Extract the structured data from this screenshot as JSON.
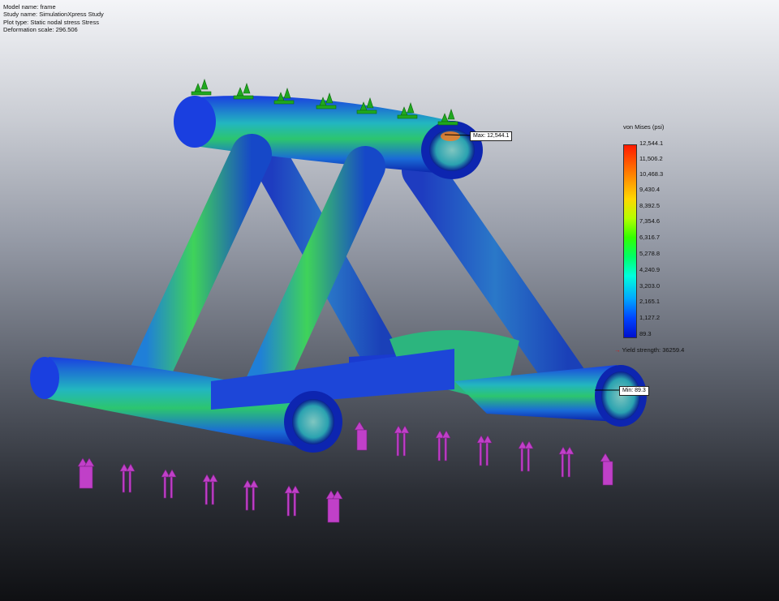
{
  "info": {
    "model_name": "Model name: frame",
    "study_name": "Study name: SimulationXpress Study",
    "plot_type": "Plot type: Static nodal stress Stress",
    "deformation_scale": "Deformation scale: 296.506"
  },
  "legend": {
    "title": "von Mises (psi)",
    "ticks": [
      "12,544.1",
      "11,506.2",
      "10,468.3",
      "9,430.4",
      "8,392.5",
      "7,354.6",
      "6,316.7",
      "5,278.8",
      "4,240.9",
      "3,203.0",
      "2,165.1",
      "1,127.2",
      "89.3"
    ],
    "yield_label": "Yield strength: 36259.4"
  },
  "callouts": {
    "max": "Max: 12,544.1",
    "min": "Min: 89.3"
  },
  "colors": {
    "stress_low": "#0a2ad8",
    "stress_mid": "#23c873",
    "stress_high": "#ff2a00",
    "fixture_green": "#1fa81f",
    "load_arrow_magenta": "#c040c8"
  }
}
